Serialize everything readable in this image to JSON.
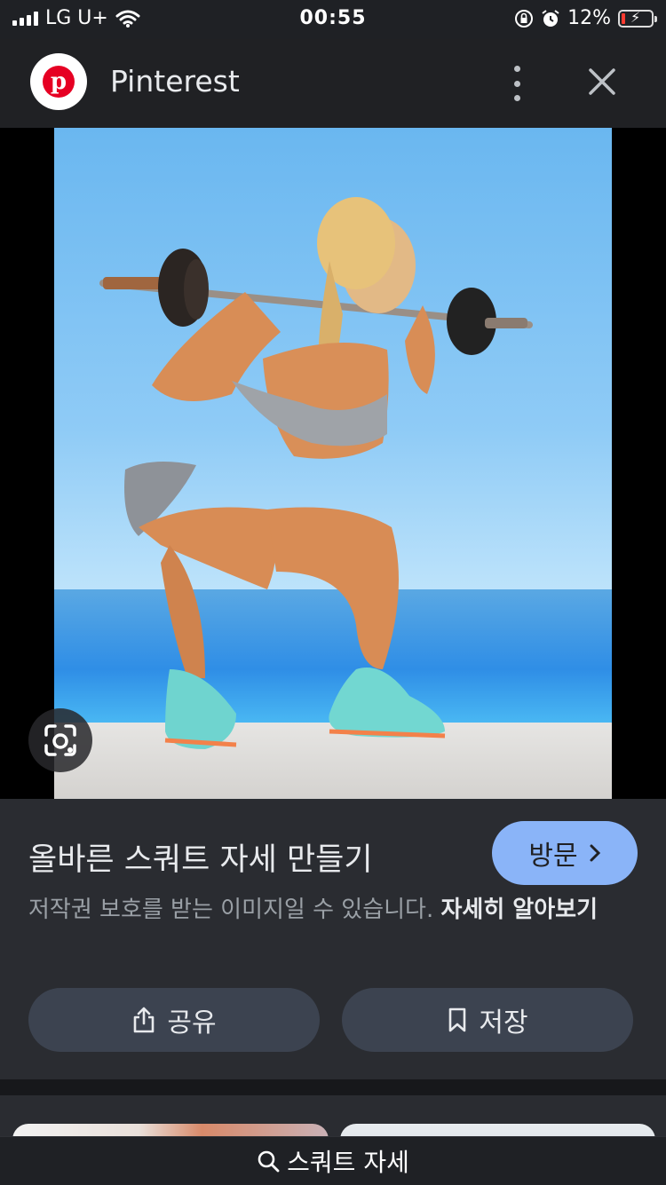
{
  "status_bar": {
    "carrier": "LG U+",
    "time": "00:55",
    "battery": "12%",
    "battery_level": 0.12
  },
  "header": {
    "logo_letter": "p",
    "title": "Pinterest"
  },
  "image": {
    "lens_icon": "lens-camera-icon"
  },
  "info": {
    "heading": "올바른 스쿼트 자세 만들기",
    "visit_label": "방문",
    "notice_text": "저작권 보호를 받는 이미지일 수 있습니다.",
    "learn_more": "자세히 알아보기",
    "share_label": "공유",
    "save_label": "저장"
  },
  "search": {
    "query": "스쿼트 자세"
  },
  "colors": {
    "accent": "#8ab4f8",
    "pinterest_red": "#e60023",
    "background": "#2a2c31",
    "button": "#3c4350"
  }
}
